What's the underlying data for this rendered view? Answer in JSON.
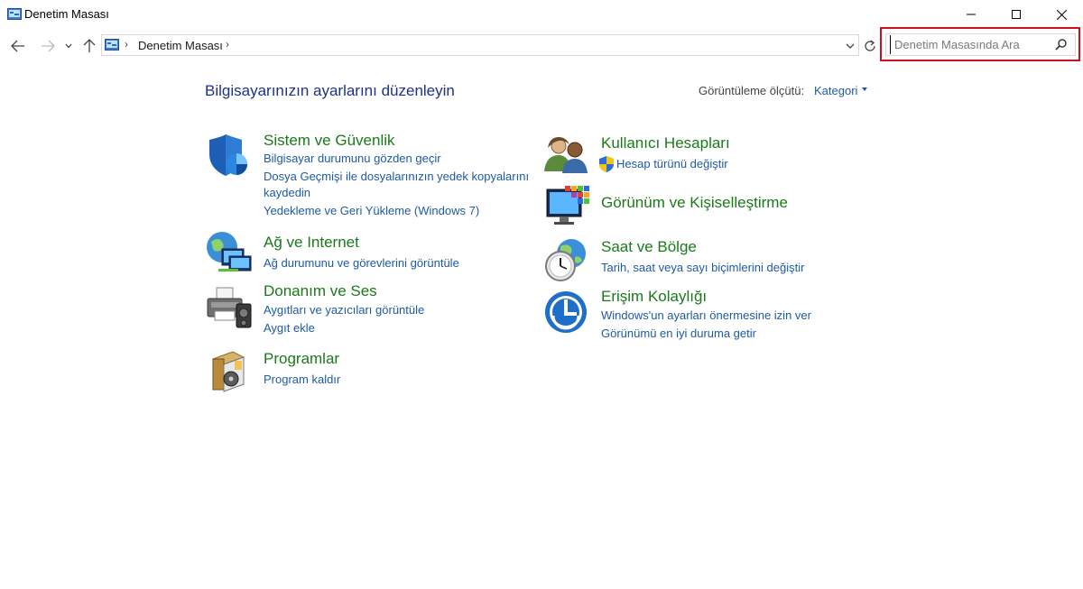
{
  "window": {
    "title": "Denetim Masası"
  },
  "address_bar": {
    "crumb": "Denetim Masası",
    "search_placeholder": "Denetim Masasında Ara"
  },
  "header": {
    "title": "Bilgisayarınızın ayarlarını düzenleyin",
    "view_label": "Görüntüleme ölçütü:",
    "view_value": "Kategori"
  },
  "categories": {
    "system_security": {
      "title": "Sistem ve Güvenlik",
      "links": [
        "Bilgisayar durumunu gözden geçir",
        "Dosya Geçmişi ile dosyalarınızın yedek kopyalarını",
        "kaydedin",
        "Yedekleme ve Geri Yükleme (Windows 7)"
      ]
    },
    "network": {
      "title": "Ağ ve Internet",
      "links": [
        "Ağ durumunu ve görevlerini görüntüle"
      ]
    },
    "hardware": {
      "title": "Donanım ve Ses",
      "links": [
        "Aygıtları ve yazıcıları görüntüle",
        "Aygıt ekle"
      ]
    },
    "programs": {
      "title": "Programlar",
      "links": [
        "Program kaldır"
      ]
    },
    "user_accounts": {
      "title": "Kullanıcı Hesapları",
      "links": [
        "Hesap türünü değiştir"
      ]
    },
    "appearance": {
      "title": "Görünüm ve Kişiselleştirme",
      "links": []
    },
    "clock_region": {
      "title": "Saat ve Bölge",
      "links": [
        "Tarih, saat veya sayı biçimlerini değiştir"
      ]
    },
    "ease_access": {
      "title": "Erişim Kolaylığı",
      "links": [
        "Windows'un ayarları önermesine izin ver",
        "Görünümü en iyi duruma getir"
      ]
    }
  },
  "colors": {
    "title_blue": "#1e3287",
    "link_blue": "#1e5aa8",
    "category_green": "#1a7a1a",
    "highlight_red": "#c8131c"
  }
}
